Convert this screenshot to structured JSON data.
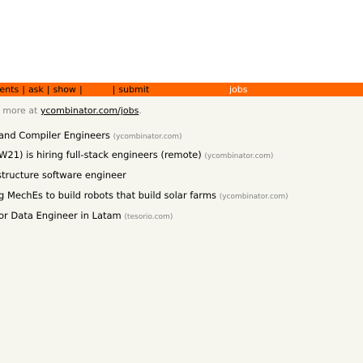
{
  "navbar": {
    "items": [
      {
        "label": "mments",
        "active": false
      },
      {
        "label": "ask",
        "active": false
      },
      {
        "label": "show",
        "active": false
      },
      {
        "label": "jobs",
        "active": true
      },
      {
        "label": "submit",
        "active": false
      }
    ],
    "separator": "|",
    "color": "#ff6600"
  },
  "intro": {
    "prefix": "e more at ",
    "link": "ycombinator.com/jobs",
    "suffix": "."
  },
  "jobs": [
    {
      "title": "and Compiler Engineers",
      "site": "(ycombinator.com)"
    },
    {
      "title": "W21) is hiring full-stack engineers (remote)",
      "site": "(ycombinator.com)"
    },
    {
      "title": "structure software engineer",
      "site": ""
    },
    {
      "title": "g MechEs to build robots that build solar farms",
      "site": "(ycombinator.com)"
    },
    {
      "title": "or Data Engineer in Latam",
      "site": "(tesorio.com)"
    }
  ]
}
